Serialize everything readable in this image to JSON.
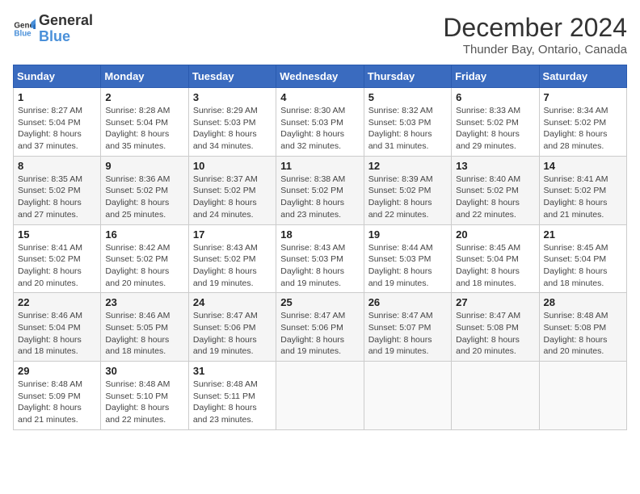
{
  "logo": {
    "text_general": "General",
    "text_blue": "Blue"
  },
  "title": "December 2024",
  "location": "Thunder Bay, Ontario, Canada",
  "days_of_week": [
    "Sunday",
    "Monday",
    "Tuesday",
    "Wednesday",
    "Thursday",
    "Friday",
    "Saturday"
  ],
  "weeks": [
    [
      {
        "day": "1",
        "sunrise": "Sunrise: 8:27 AM",
        "sunset": "Sunset: 5:04 PM",
        "daylight": "Daylight: 8 hours and 37 minutes."
      },
      {
        "day": "2",
        "sunrise": "Sunrise: 8:28 AM",
        "sunset": "Sunset: 5:04 PM",
        "daylight": "Daylight: 8 hours and 35 minutes."
      },
      {
        "day": "3",
        "sunrise": "Sunrise: 8:29 AM",
        "sunset": "Sunset: 5:03 PM",
        "daylight": "Daylight: 8 hours and 34 minutes."
      },
      {
        "day": "4",
        "sunrise": "Sunrise: 8:30 AM",
        "sunset": "Sunset: 5:03 PM",
        "daylight": "Daylight: 8 hours and 32 minutes."
      },
      {
        "day": "5",
        "sunrise": "Sunrise: 8:32 AM",
        "sunset": "Sunset: 5:03 PM",
        "daylight": "Daylight: 8 hours and 31 minutes."
      },
      {
        "day": "6",
        "sunrise": "Sunrise: 8:33 AM",
        "sunset": "Sunset: 5:02 PM",
        "daylight": "Daylight: 8 hours and 29 minutes."
      },
      {
        "day": "7",
        "sunrise": "Sunrise: 8:34 AM",
        "sunset": "Sunset: 5:02 PM",
        "daylight": "Daylight: 8 hours and 28 minutes."
      }
    ],
    [
      {
        "day": "8",
        "sunrise": "Sunrise: 8:35 AM",
        "sunset": "Sunset: 5:02 PM",
        "daylight": "Daylight: 8 hours and 27 minutes."
      },
      {
        "day": "9",
        "sunrise": "Sunrise: 8:36 AM",
        "sunset": "Sunset: 5:02 PM",
        "daylight": "Daylight: 8 hours and 25 minutes."
      },
      {
        "day": "10",
        "sunrise": "Sunrise: 8:37 AM",
        "sunset": "Sunset: 5:02 PM",
        "daylight": "Daylight: 8 hours and 24 minutes."
      },
      {
        "day": "11",
        "sunrise": "Sunrise: 8:38 AM",
        "sunset": "Sunset: 5:02 PM",
        "daylight": "Daylight: 8 hours and 23 minutes."
      },
      {
        "day": "12",
        "sunrise": "Sunrise: 8:39 AM",
        "sunset": "Sunset: 5:02 PM",
        "daylight": "Daylight: 8 hours and 22 minutes."
      },
      {
        "day": "13",
        "sunrise": "Sunrise: 8:40 AM",
        "sunset": "Sunset: 5:02 PM",
        "daylight": "Daylight: 8 hours and 22 minutes."
      },
      {
        "day": "14",
        "sunrise": "Sunrise: 8:41 AM",
        "sunset": "Sunset: 5:02 PM",
        "daylight": "Daylight: 8 hours and 21 minutes."
      }
    ],
    [
      {
        "day": "15",
        "sunrise": "Sunrise: 8:41 AM",
        "sunset": "Sunset: 5:02 PM",
        "daylight": "Daylight: 8 hours and 20 minutes."
      },
      {
        "day": "16",
        "sunrise": "Sunrise: 8:42 AM",
        "sunset": "Sunset: 5:02 PM",
        "daylight": "Daylight: 8 hours and 20 minutes."
      },
      {
        "day": "17",
        "sunrise": "Sunrise: 8:43 AM",
        "sunset": "Sunset: 5:02 PM",
        "daylight": "Daylight: 8 hours and 19 minutes."
      },
      {
        "day": "18",
        "sunrise": "Sunrise: 8:43 AM",
        "sunset": "Sunset: 5:03 PM",
        "daylight": "Daylight: 8 hours and 19 minutes."
      },
      {
        "day": "19",
        "sunrise": "Sunrise: 8:44 AM",
        "sunset": "Sunset: 5:03 PM",
        "daylight": "Daylight: 8 hours and 19 minutes."
      },
      {
        "day": "20",
        "sunrise": "Sunrise: 8:45 AM",
        "sunset": "Sunset: 5:04 PM",
        "daylight": "Daylight: 8 hours and 18 minutes."
      },
      {
        "day": "21",
        "sunrise": "Sunrise: 8:45 AM",
        "sunset": "Sunset: 5:04 PM",
        "daylight": "Daylight: 8 hours and 18 minutes."
      }
    ],
    [
      {
        "day": "22",
        "sunrise": "Sunrise: 8:46 AM",
        "sunset": "Sunset: 5:04 PM",
        "daylight": "Daylight: 8 hours and 18 minutes."
      },
      {
        "day": "23",
        "sunrise": "Sunrise: 8:46 AM",
        "sunset": "Sunset: 5:05 PM",
        "daylight": "Daylight: 8 hours and 18 minutes."
      },
      {
        "day": "24",
        "sunrise": "Sunrise: 8:47 AM",
        "sunset": "Sunset: 5:06 PM",
        "daylight": "Daylight: 8 hours and 19 minutes."
      },
      {
        "day": "25",
        "sunrise": "Sunrise: 8:47 AM",
        "sunset": "Sunset: 5:06 PM",
        "daylight": "Daylight: 8 hours and 19 minutes."
      },
      {
        "day": "26",
        "sunrise": "Sunrise: 8:47 AM",
        "sunset": "Sunset: 5:07 PM",
        "daylight": "Daylight: 8 hours and 19 minutes."
      },
      {
        "day": "27",
        "sunrise": "Sunrise: 8:47 AM",
        "sunset": "Sunset: 5:08 PM",
        "daylight": "Daylight: 8 hours and 20 minutes."
      },
      {
        "day": "28",
        "sunrise": "Sunrise: 8:48 AM",
        "sunset": "Sunset: 5:08 PM",
        "daylight": "Daylight: 8 hours and 20 minutes."
      }
    ],
    [
      {
        "day": "29",
        "sunrise": "Sunrise: 8:48 AM",
        "sunset": "Sunset: 5:09 PM",
        "daylight": "Daylight: 8 hours and 21 minutes."
      },
      {
        "day": "30",
        "sunrise": "Sunrise: 8:48 AM",
        "sunset": "Sunset: 5:10 PM",
        "daylight": "Daylight: 8 hours and 22 minutes."
      },
      {
        "day": "31",
        "sunrise": "Sunrise: 8:48 AM",
        "sunset": "Sunset: 5:11 PM",
        "daylight": "Daylight: 8 hours and 23 minutes."
      },
      null,
      null,
      null,
      null
    ]
  ]
}
